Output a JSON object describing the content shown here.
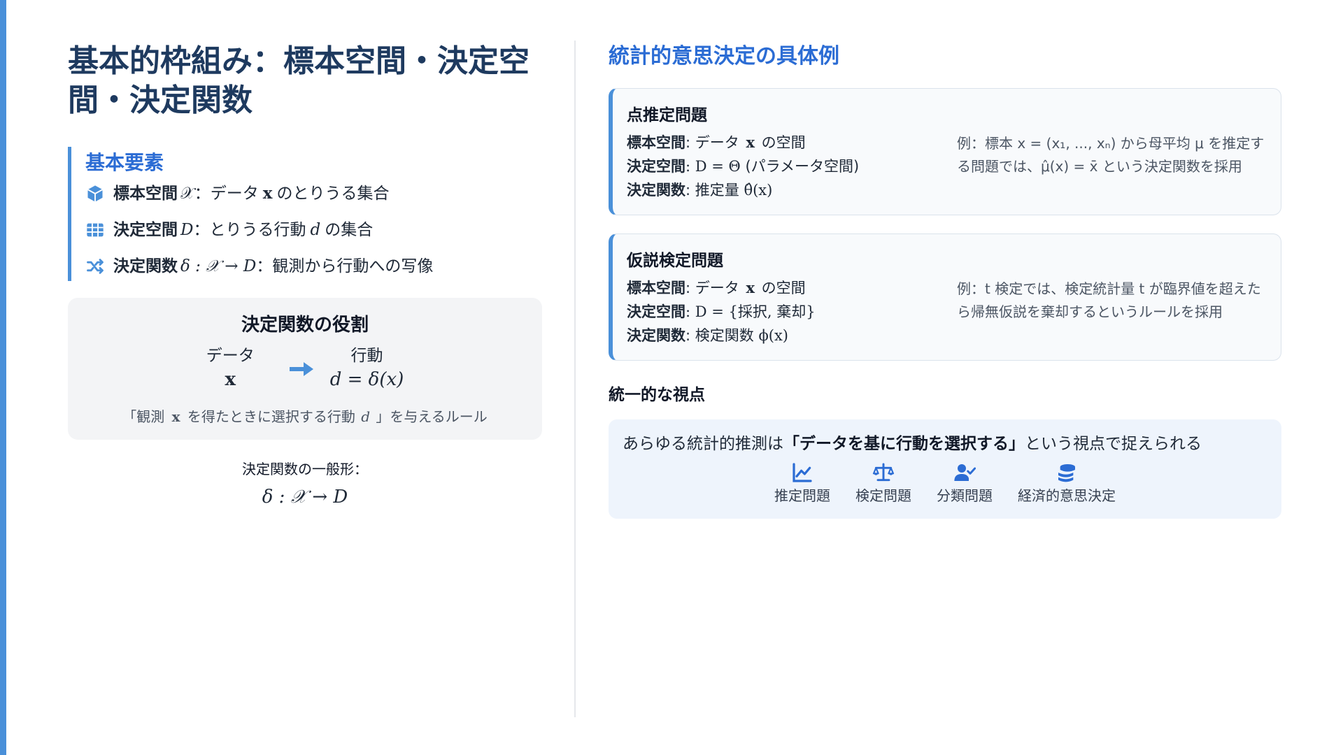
{
  "title": "基本的枠組み：標本空間・決定空間・決定関数",
  "basic": {
    "heading": "基本要素",
    "items": [
      {
        "label": "標本空間",
        "symbol": "𝒳",
        "sep": "：",
        "rest_a": "データ",
        "var": "x",
        "rest_b": "のとりうる集合",
        "icon": "cube-icon"
      },
      {
        "label": "決定空間",
        "symbol": "D",
        "sep": "：",
        "rest_a": "とりうる行動",
        "var": "d",
        "rest_b": "の集合",
        "icon": "table-icon"
      },
      {
        "label": "決定関数",
        "symbol": "δ : 𝒳 → D",
        "sep": "：",
        "rest_a": "観測から行動への写像",
        "var": "",
        "rest_b": "",
        "icon": "shuffle-icon"
      }
    ]
  },
  "role": {
    "heading": "決定関数の役割",
    "input_label": "データ",
    "input_symbol": "x",
    "output_label": "行動",
    "output_symbol": "d = δ(x)",
    "note_pre": "「観測",
    "note_var1": "x",
    "note_mid": "を得たときに選択する行動",
    "note_var2": "d",
    "note_post": "」を与えるルール"
  },
  "general": {
    "label": "決定関数の一般形：",
    "formula": "δ : 𝒳 → D"
  },
  "examples": {
    "heading": "統計的意思決定の具体例",
    "point": {
      "title": "点推定問題",
      "sample_label": "標本空間",
      "sample_pre": ": データ",
      "sample_var": "x",
      "sample_post": "の空間",
      "decision_label": "決定空間",
      "decision_math": ": D = Θ",
      "decision_post": "(パラメータ空間)",
      "func_label": "決定関数",
      "func_pre": ": 推定量",
      "func_math": "θ̂(x)",
      "example": "例：標本 x = (x₁, ..., xₙ) から母平均 μ を推定する問題では、μ̂(x) = x̄ という決定関数を採用"
    },
    "test": {
      "title": "仮説検定問題",
      "sample_label": "標本空間",
      "sample_pre": ": データ",
      "sample_var": "x",
      "sample_post": "の空間",
      "decision_label": "決定空間",
      "decision_math": ": D = {採択, 棄却}",
      "func_label": "決定関数",
      "func_pre": ": 検定関数",
      "func_math": "ϕ(x)",
      "example": "例：t 検定では、検定統計量 t が臨界値を超えたら帰無仮説を棄却するというルールを採用"
    }
  },
  "unified": {
    "heading": "統一的な視点",
    "text_pre": "あらゆる統計的推測は",
    "text_bold": "「データを基に行動を選択する」",
    "text_post": "という視点で捉えられる",
    "chips": [
      {
        "label": "推定問題",
        "icon": "line-chart-icon"
      },
      {
        "label": "検定問題",
        "icon": "balance-scale-icon"
      },
      {
        "label": "分類問題",
        "icon": "user-check-icon"
      },
      {
        "label": "経済的意思決定",
        "icon": "coins-icon"
      }
    ]
  },
  "colors": {
    "accent": "#4a90d9",
    "heading_blue": "#2b6cd4",
    "title_navy": "#1e3a5f"
  }
}
